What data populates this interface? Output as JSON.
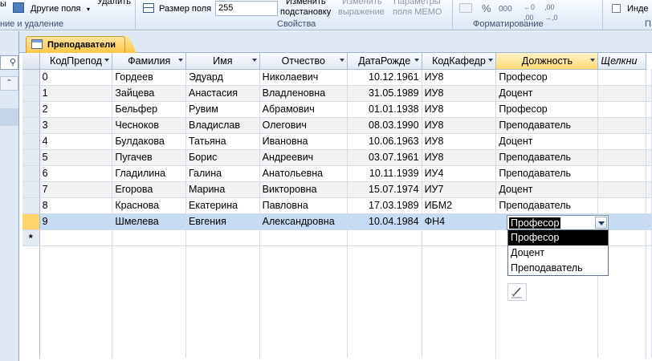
{
  "ribbon": {
    "delete_label": "Удалить",
    "other_fields_label": "Другие поля",
    "field_size_label": "Размер поля",
    "field_size_value": "255",
    "change_lookup_label1": "Изменить",
    "change_lookup_label2": "подстановку",
    "change_expr_label1": "Изменить",
    "change_expr_label2": "выражение",
    "memo_params_label1": "Параметры",
    "memo_params_label2": "поля MEMO",
    "percent": "%",
    "thousands": "000",
    "index_label": "Инде",
    "group_add_delete": "ние и удаление",
    "group_properties": "Свойства",
    "group_formatting": "Форматирование",
    "group_last": "П"
  },
  "tab": {
    "label": "Преподаватели"
  },
  "grid": {
    "columns": [
      "КодПрепод",
      "Фамилия",
      "Имя",
      "Отчество",
      "ДатаРожде",
      "КодКафедр",
      "Должность",
      "Щелкни"
    ],
    "rows": [
      {
        "id": "0",
        "last": "Гордеев",
        "first": "Эдуард",
        "middle": "Николаевич",
        "dob": "10.12.1961",
        "dept": "ИУ8",
        "pos": "Професор"
      },
      {
        "id": "1",
        "last": "Зайцева",
        "first": "Анастасия",
        "middle": "Владленовна",
        "dob": "31.05.1989",
        "dept": "ИУ8",
        "pos": "Доцент"
      },
      {
        "id": "2",
        "last": "Бельфер",
        "first": "Рувим",
        "middle": "Абрамович",
        "dob": "01.01.1938",
        "dept": "ИУ8",
        "pos": "Професор"
      },
      {
        "id": "3",
        "last": "Чесноков",
        "first": "Владислав",
        "middle": "Олегович",
        "dob": "08.03.1990",
        "dept": "ИУ8",
        "pos": "Преподаватель"
      },
      {
        "id": "4",
        "last": "Булдакова",
        "first": "Татьяна",
        "middle": "Ивановна",
        "dob": "10.06.1963",
        "dept": "ИУ8",
        "pos": "Доцент"
      },
      {
        "id": "5",
        "last": "Пугачев",
        "first": "Борис",
        "middle": "Андреевич",
        "dob": "03.07.1961",
        "dept": "ИУ8",
        "pos": "Преподаватель"
      },
      {
        "id": "6",
        "last": "Гладилина",
        "first": "Галина",
        "middle": "Анатольевна",
        "dob": "10.11.1939",
        "dept": "ИУ4",
        "pos": "Преподаватель"
      },
      {
        "id": "7",
        "last": "Егорова",
        "first": "Марина",
        "middle": "Викторовна",
        "dob": "15.07.1974",
        "dept": "ИУ7",
        "pos": "Доцент"
      },
      {
        "id": "8",
        "last": "Краснова",
        "first": "Екатерина",
        "middle": "Павловна",
        "dob": "17.03.1989",
        "dept": "ИБМ2",
        "pos": "Преподаватель"
      },
      {
        "id": "9",
        "last": "Шмелева",
        "first": "Евгения",
        "middle": "Александровна",
        "dob": "10.04.1984",
        "dept": "ФН4",
        "pos": ""
      }
    ],
    "new_row_marker": "*"
  },
  "dropdown": {
    "current_value": "Професор",
    "options": [
      "Професор",
      "Доцент",
      "Преподаватель"
    ]
  }
}
